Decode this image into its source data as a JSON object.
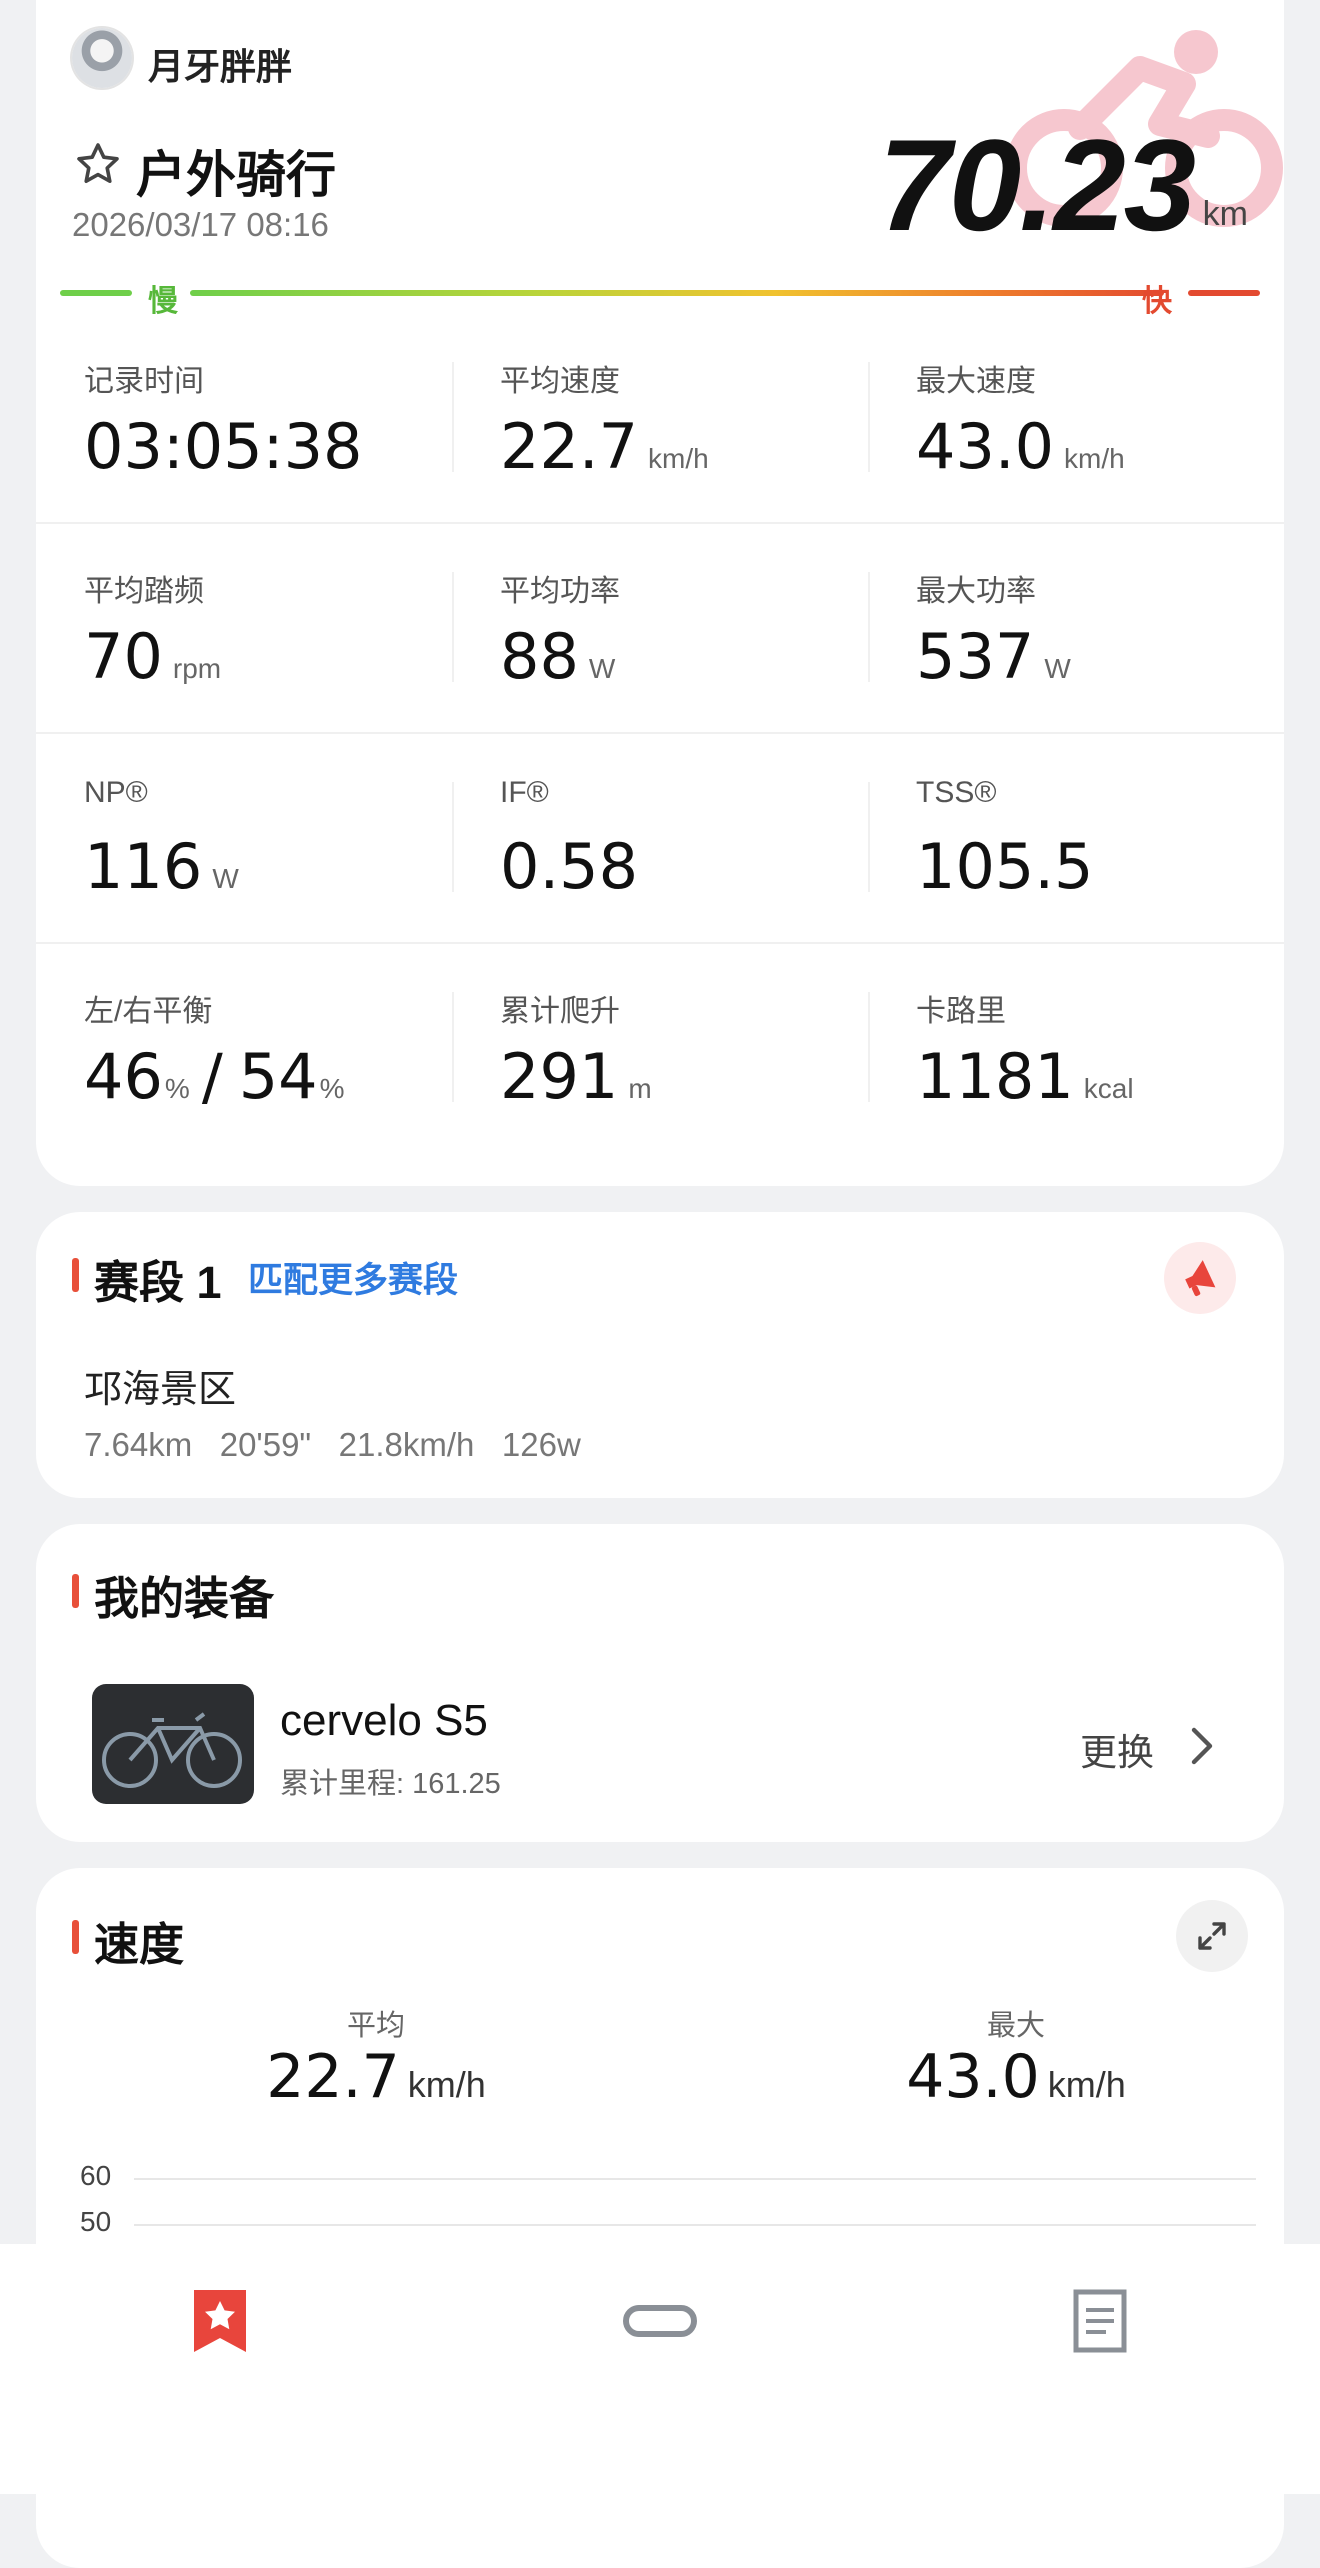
{
  "header": {
    "username": "月牙胖胖",
    "sport_type": "户外骑行",
    "datetime": "2026/03/17 08:16",
    "distance": "70.23",
    "distance_unit": "km",
    "slow_label": "慢",
    "fast_label": "快"
  },
  "stats": [
    {
      "label": "记录时间",
      "value": "03:05:38",
      "unit": ""
    },
    {
      "label": "平均速度",
      "value": "22.7",
      "unit": "km/h"
    },
    {
      "label": "最大速度",
      "value": "43.0",
      "unit": "km/h"
    },
    {
      "label": "平均踏频",
      "value": "70",
      "unit": "rpm"
    },
    {
      "label": "平均功率",
      "value": "88",
      "unit": "W"
    },
    {
      "label": "最大功率",
      "value": "537",
      "unit": "W"
    },
    {
      "label": "NP®",
      "value": "116",
      "unit": "W"
    },
    {
      "label": "IF®",
      "value": "0.58",
      "unit": ""
    },
    {
      "label": "TSS®",
      "value": "105.5",
      "unit": ""
    },
    {
      "label": "左/右平衡",
      "left_value": "46",
      "left_unit": "%",
      "slash": "/",
      "right_value": "54",
      "right_unit": "%"
    },
    {
      "label": "累计爬升",
      "value": "291",
      "unit": "m"
    },
    {
      "label": "卡路里",
      "value": "1181",
      "unit": "kcal"
    }
  ],
  "segment": {
    "title": "赛段 1",
    "match_link": "匹配更多赛段",
    "name": "邛海景区",
    "stats": "7.64km   20'59\"   21.8km/h   126w"
  },
  "equipment": {
    "title": "我的装备",
    "bike_name": "cervelo S5",
    "mileage": "累计里程: 161.25",
    "change_label": "更换"
  },
  "speed": {
    "title": "速度",
    "avg_label": "平均",
    "avg_value": "22.7",
    "avg_unit": "km/h",
    "max_label": "最大",
    "max_value": "43.0",
    "max_unit": "km/h",
    "y_ticks": [
      "60",
      "50"
    ]
  },
  "bottom_nav": {
    "items": [
      "bookmark-star-icon",
      "link-icon",
      "document-icon"
    ],
    "active_color": "#e8453c"
  },
  "colors": {
    "accent": "#e8503a",
    "link": "#2f7be0",
    "slow": "#6fcf4a",
    "fast": "#e34a30"
  }
}
